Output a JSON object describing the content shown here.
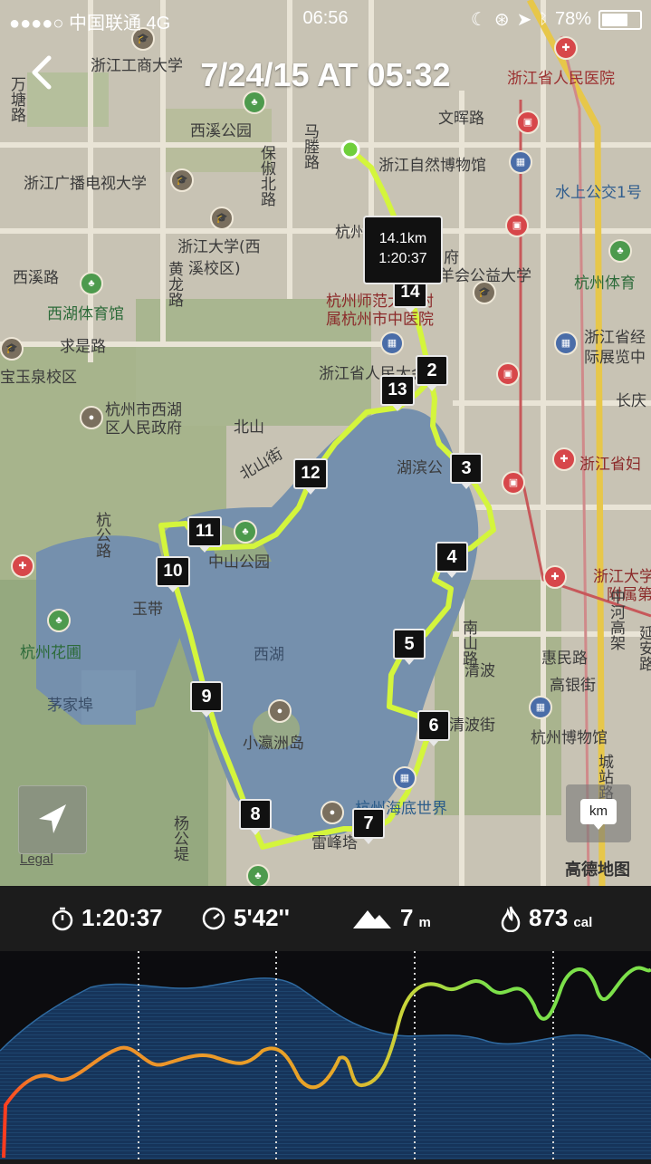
{
  "status_bar": {
    "carrier": "●●●●○ 中国联通  4G",
    "time": "06:56",
    "battery": "78%",
    "battery_level": 0.78
  },
  "header": {
    "title": "7/24/15 AT 05:32"
  },
  "map": {
    "callout": {
      "distance": "14.1km",
      "time": "1:20:37"
    },
    "km_markers": [
      "2",
      "3",
      "4",
      "5",
      "6",
      "7",
      "8",
      "9",
      "10",
      "11",
      "12",
      "13",
      "14"
    ],
    "labels": [
      "浙江工商大学",
      "西溪公园",
      "文晖路",
      "浙江省人民医院",
      "马塍路",
      "浙江自然博物馆",
      "浙江广播电视大学",
      "保俶北路",
      "水上公交1号",
      "杭州",
      "府",
      "浙江大学(西",
      "溪校区)",
      "羊会公益大学",
      "杭州体育",
      "西溪路",
      "西湖体育馆",
      "黄龙路",
      "杭州师范大学附",
      "属杭州市中医院",
      "求是路",
      "浙江省人民大会堂",
      "浙江省经",
      "际展览中",
      "宝玉泉校区",
      "杭州市西湖",
      "区人民政府",
      "北山",
      "长庆",
      "北山街",
      "湖滨公",
      "浙江省妇",
      "杭公路",
      "中山公园",
      "玉带",
      "浙江大学",
      "附属第",
      "杭州花圃",
      "西湖",
      "南山路",
      "清波",
      "惠民路",
      "高银街",
      "中河高架",
      "茅家埠",
      "小瀛洲岛",
      "延安路",
      "杭州博物馆",
      "杭州海底世界",
      "雷峰塔",
      "杨公堤",
      "城站路",
      "万塘路",
      "清波街"
    ],
    "legal": "Legal",
    "unit_badge": "km",
    "provider": "高德地图",
    "route_color": "#d4f53c"
  },
  "stats": {
    "duration": "1:20:37",
    "pace": "5'42''",
    "elevation_value": "7",
    "elevation_unit": "m",
    "calories_value": "873",
    "calories_unit": "cal"
  }
}
